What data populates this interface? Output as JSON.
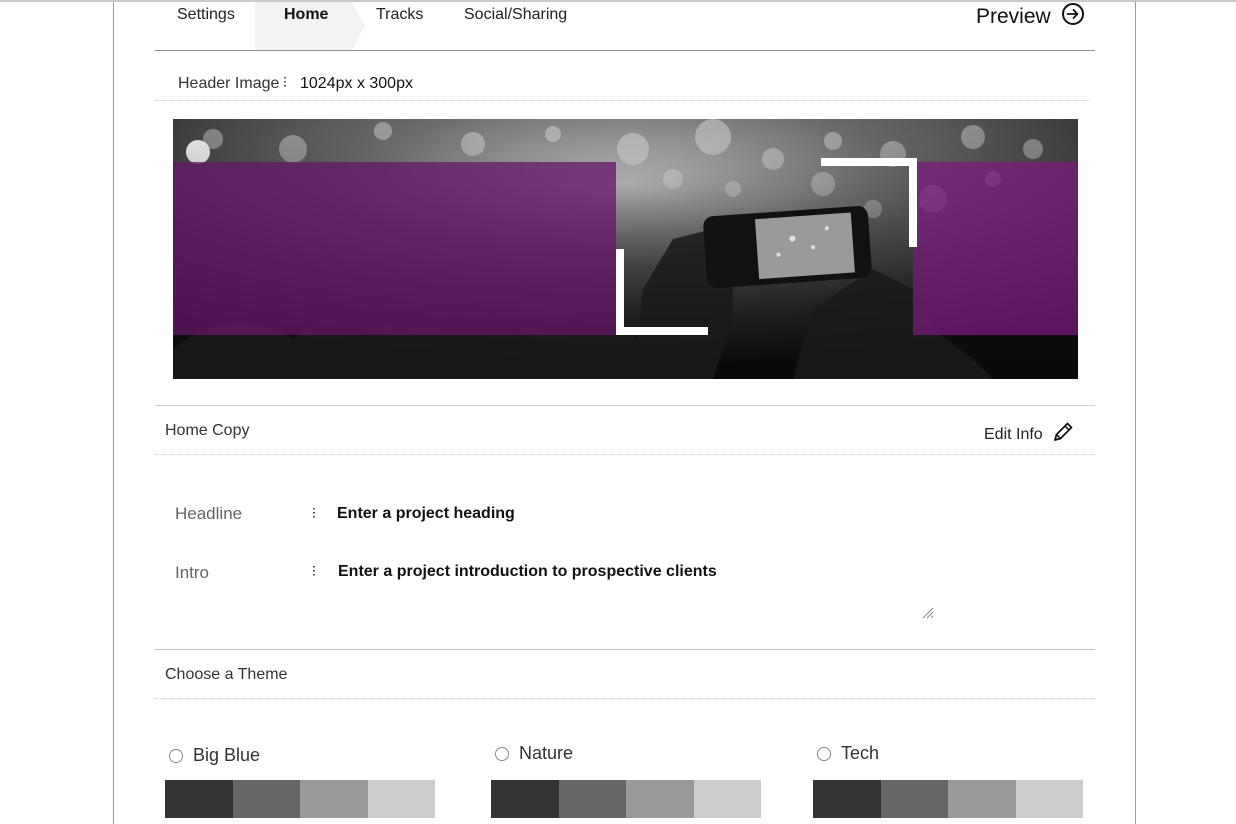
{
  "tabs": [
    {
      "label": "Settings",
      "active": false
    },
    {
      "label": "Home",
      "active": true
    },
    {
      "label": "Tracks",
      "active": false
    },
    {
      "label": "Social/Sharing",
      "active": false
    }
  ],
  "preview": {
    "label": "Preview",
    "icon": "arrow-right-circle-icon"
  },
  "header_image": {
    "label": "Header Image",
    "size": "1024px x 300px"
  },
  "home_copy": {
    "title": "Home Copy",
    "edit_label": "Edit Info",
    "edit_icon": "pencil-icon",
    "fields": {
      "headline": {
        "label": "Headline",
        "value": "Enter a project heading"
      },
      "intro": {
        "label": "Intro",
        "value": "Enter a project introduction to prospective clients"
      }
    }
  },
  "theme": {
    "title": "Choose a Theme",
    "options": [
      {
        "name": "Big Blue",
        "swatches": [
          "#333333",
          "#666666",
          "#999999",
          "#cccccc"
        ]
      },
      {
        "name": "Nature",
        "swatches": [
          "#333333",
          "#666666",
          "#999999",
          "#cccccc"
        ]
      },
      {
        "name": "Tech",
        "swatches": [
          "#333333",
          "#666666",
          "#999999",
          "#cccccc"
        ]
      }
    ]
  },
  "colors": {
    "accent_overlay": "#7a1a7f"
  }
}
